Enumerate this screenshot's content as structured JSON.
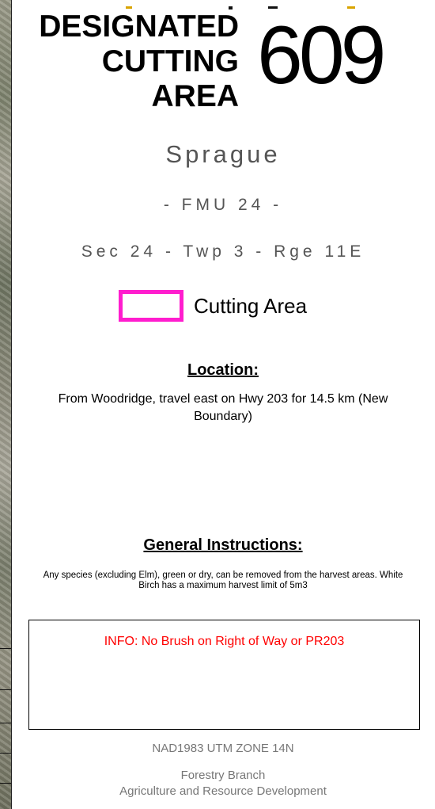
{
  "title": {
    "lines": [
      "DESIGNATED",
      "CUTTING",
      "AREA"
    ],
    "number": "609"
  },
  "place_name": "Sprague",
  "fmu": "- FMU 24 -",
  "legal_description": "Sec 24 - Twp 3 - Rge 11E",
  "legend": {
    "label": "Cutting Area",
    "color": "#ff1dce"
  },
  "location": {
    "heading": "Location:",
    "text": "From Woodridge, travel east on Hwy 203 for 14.5 km (New Boundary)"
  },
  "general_instructions": {
    "heading": "General Instructions:",
    "text": "Any species (excluding Elm), green or dry, can be removed from the harvest areas.  White Birch has a maximum harvest limit of 5m3"
  },
  "info": {
    "text": "INFO:  No Brush on Right of Way or PR203",
    "color": "#ff0000"
  },
  "footer": {
    "projection": "NAD1983 UTM ZONE 14N",
    "branch": "Forestry Branch",
    "department": "Agriculture and Resource Development"
  }
}
